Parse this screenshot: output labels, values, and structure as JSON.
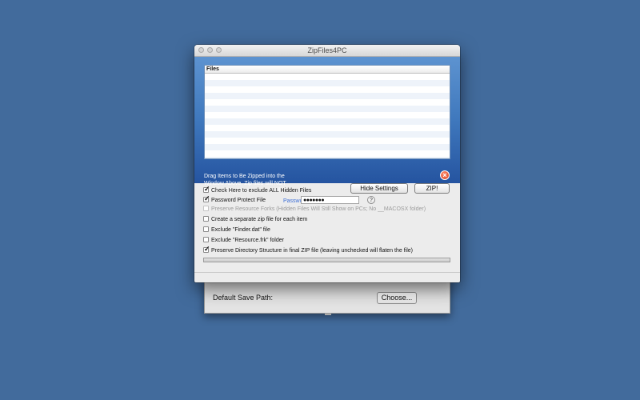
{
  "window": {
    "title": "ZipFiles4PC"
  },
  "file_list": {
    "header": "Files"
  },
  "drop_hint": "Drag Items to Be Zipped into the Window Above.  Zip files will NOT contain .DS_Store or Mac stuff.",
  "buttons": {
    "hide_settings": "Hide Settings",
    "zip": "ZIP!"
  },
  "options": {
    "exclude_hidden": {
      "label": "Check Here to exclude ALL Hidden Files",
      "checked": true
    },
    "password_protect": {
      "label": "Password Protect File",
      "checked": true
    },
    "password_label": "Password:",
    "password_value": "●●●●●●●",
    "help": "?",
    "preserve_forks": {
      "label": "Preserve Resource Forks (Hidden Files Will Still Show on PCs; No __MACOSX folder)",
      "checked": false,
      "enabled": false
    },
    "separate_zip": {
      "label": "Create a separate zip file for each item",
      "checked": false
    },
    "exclude_finder_dat": {
      "label": "Exclude \"Finder.dat\" file",
      "checked": false
    },
    "exclude_resource_frk": {
      "label": "Exclude \"Resource.frk\" folder",
      "checked": false
    },
    "preserve_structure": {
      "label": "Preserve Directory Structure in final ZIP file (leaving unchecked will flaten the file)",
      "checked": true
    }
  },
  "progress": 0,
  "save_sheet": {
    "label": "Default Save Path:",
    "choose": "Choose..."
  },
  "colors": {
    "desktop": "#426b9c",
    "panel_blue": "#3f78bd",
    "link_blue": "#3d6fd6"
  }
}
